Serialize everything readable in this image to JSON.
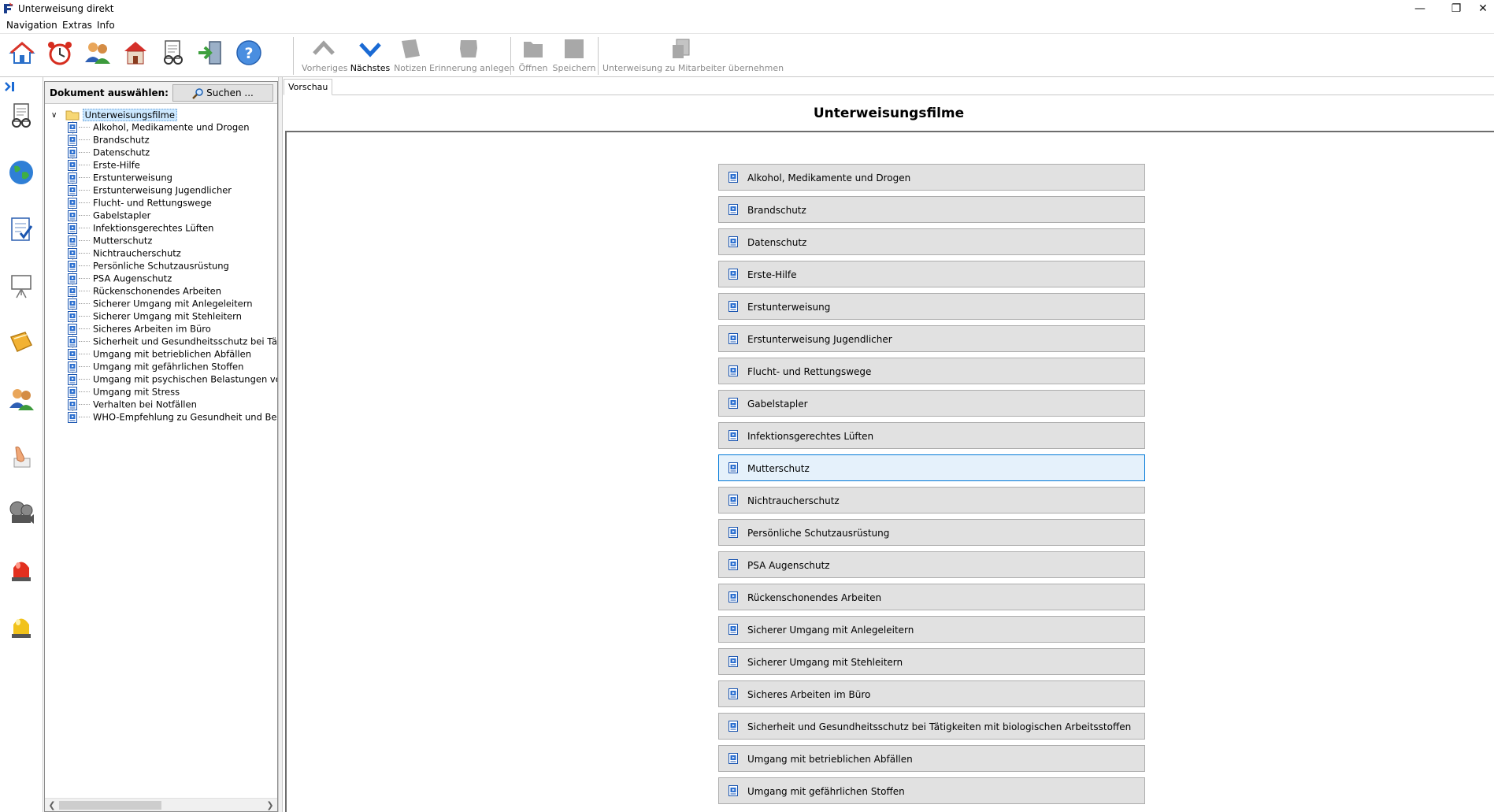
{
  "window": {
    "title": "Unterweisung direkt",
    "controls": {
      "minimize": "—",
      "restore": "❐",
      "close": "✕"
    }
  },
  "menu": [
    "Navigation",
    "Extras",
    "Info"
  ],
  "toolbar": {
    "icons": [
      "home-icon",
      "alarm-clock-icon",
      "users-icon",
      "house-icon",
      "documents-search-icon",
      "exit-icon",
      "help-icon"
    ],
    "buttons": {
      "previous": "Vorheriges",
      "next": "Nächstes",
      "notes": "Notizen",
      "reminder": "Erinnerung anlegen",
      "open": "Öffnen",
      "save": "Speichern",
      "transfer": "Unterweisung zu Mitarbeiter übernehmen"
    }
  },
  "sidebar": {
    "icons": [
      "collapse-icon",
      "documents-search-icon",
      "globe-icon",
      "checklist-icon",
      "presentation-icon",
      "book-icon",
      "users-icon",
      "hand-icon",
      "film-reel-icon",
      "red-alarm-light-icon",
      "yellow-alarm-light-icon"
    ]
  },
  "tree": {
    "header_label": "Dokument auswählen:",
    "search_label": "Suchen ...",
    "root": "Unterweisungsfilme",
    "items": [
      "Alkohol, Medikamente und Drogen",
      "Brandschutz",
      "Datenschutz",
      "Erste-Hilfe",
      "Erstunterweisung",
      "Erstunterweisung Jugendlicher",
      "Flucht- und Rettungswege",
      "Gabelstapler",
      "Infektionsgerechtes Lüften",
      "Mutterschutz",
      "Nichtraucherschutz",
      "Persönliche Schutzausrüstung",
      "PSA Augenschutz",
      "Rückenschonendes Arbeiten",
      "Sicherer Umgang mit Anlegeleitern",
      "Sicherer Umgang mit Stehleitern",
      "Sicheres Arbeiten im Büro",
      "Sicherheit und Gesundheitsschutz bei Tätigke",
      "Umgang mit betrieblichen Abfällen",
      "Umgang mit gefährlichen Stoffen",
      "Umgang mit psychischen Belastungen von Be",
      "Umgang mit Stress",
      "Verhalten bei Notfällen",
      "WHO-Empfehlung zu Gesundheit und Bewegu"
    ]
  },
  "preview": {
    "tab": "Vorschau",
    "title": "Unterweisungsfilme",
    "active_item": "Mutterschutz",
    "items": [
      "Alkohol, Medikamente und Drogen",
      "Brandschutz",
      "Datenschutz",
      "Erste-Hilfe",
      "Erstunterweisung",
      "Erstunterweisung Jugendlicher",
      "Flucht- und Rettungswege",
      "Gabelstapler",
      "Infektionsgerechtes Lüften",
      "Mutterschutz",
      "Nichtraucherschutz",
      "Persönliche Schutzausrüstung",
      "PSA Augenschutz",
      "Rückenschonendes Arbeiten",
      "Sicherer Umgang mit Anlegeleitern",
      "Sicherer Umgang mit Stehleitern",
      "Sicheres Arbeiten im Büro",
      "Sicherheit und Gesundheitsschutz bei Tätigkeiten mit biologischen Arbeitsstoffen",
      "Umgang mit betrieblichen Abfällen",
      "Umgang mit gefährlichen Stoffen"
    ]
  },
  "colors": {
    "accent_blue": "#0a64c8",
    "active_button_bg": "#e5f1fb",
    "active_button_border": "#0078d7",
    "button_bg": "#e1e1e1"
  }
}
